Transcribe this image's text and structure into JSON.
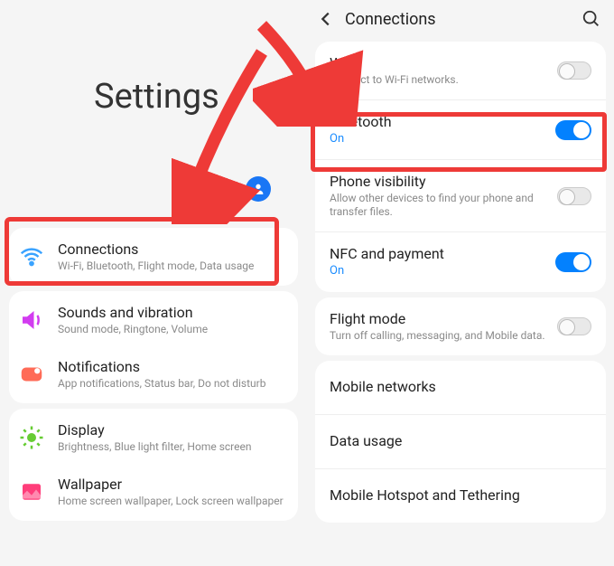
{
  "left": {
    "title": "Settings",
    "items": [
      {
        "title": "Connections",
        "sub": "Wi-Fi, Bluetooth, Flight mode, Data usage"
      },
      {
        "title": "Sounds and vibration",
        "sub": "Sound mode, Ringtone, Volume"
      },
      {
        "title": "Notifications",
        "sub": "App notifications, Status bar, Do not disturb"
      },
      {
        "title": "Display",
        "sub": "Brightness, Blue light filter, Home screen"
      },
      {
        "title": "Wallpaper",
        "sub": "Home screen wallpaper, Lock screen wallpaper"
      }
    ]
  },
  "right": {
    "title": "Connections",
    "group1": [
      {
        "title": "Wi-Fi",
        "sub": "Connect to Wi-Fi networks.",
        "toggle": "off"
      },
      {
        "title": "Bluetooth",
        "sub": "On",
        "subClass": "blue",
        "toggle": "on"
      },
      {
        "title": "Phone visibility",
        "sub": "Allow other devices to find your phone and transfer files.",
        "toggle": "off"
      },
      {
        "title": "NFC and payment",
        "sub": "On",
        "subClass": "blue",
        "toggle": "on"
      }
    ],
    "group2": [
      {
        "title": "Flight mode",
        "sub": "Turn off calling, messaging, and Mobile data.",
        "toggle": "off"
      }
    ],
    "group3": [
      {
        "title": "Mobile networks"
      },
      {
        "title": "Data usage"
      },
      {
        "title": "Mobile Hotspot and Tethering"
      }
    ]
  }
}
